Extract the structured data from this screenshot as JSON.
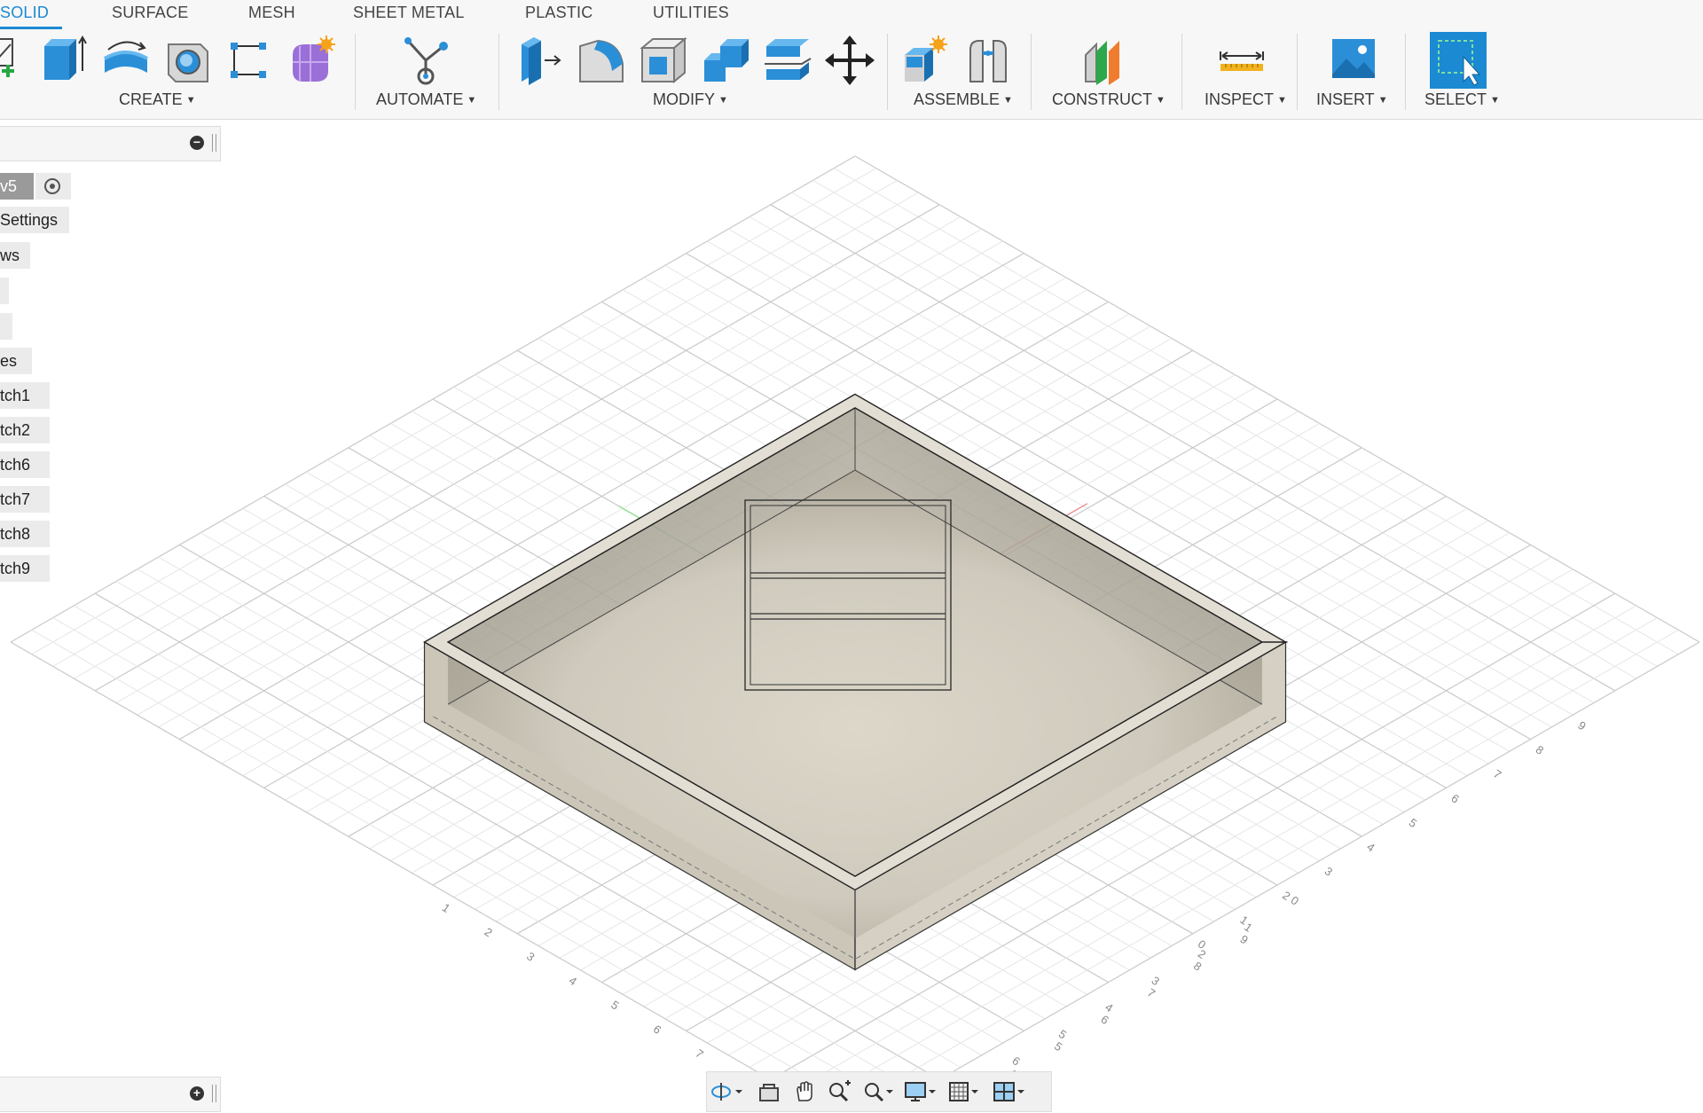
{
  "tabs": [
    "SOLID",
    "SURFACE",
    "MESH",
    "SHEET METAL",
    "PLASTIC",
    "UTILITIES"
  ],
  "groups": {
    "create": "CREATE",
    "automate": "AUTOMATE",
    "modify": "MODIFY",
    "assemble": "ASSEMBLE",
    "construct": "CONSTRUCT",
    "inspect": "INSPECT",
    "insert": "INSERT",
    "select": "SELECT"
  },
  "browser": {
    "document": "v5",
    "items": [
      "Settings",
      "ws",
      "",
      "",
      "es",
      "tch1",
      "tch2",
      "tch6",
      "tch7",
      "tch8",
      "tch9"
    ]
  },
  "icons": {
    "create": [
      "create-sketch-icon",
      "extrude-icon",
      "revolve-icon",
      "hole-icon",
      "pattern-icon",
      "create-form-icon"
    ],
    "automate": [
      "automate-icon"
    ],
    "modify": [
      "press-pull-icon",
      "fillet-icon",
      "shell-icon",
      "combine-icon",
      "split-body-icon",
      "move-icon"
    ],
    "assemble": [
      "new-component-icon",
      "joint-icon"
    ],
    "construct": [
      "plane-icon"
    ],
    "inspect": [
      "measure-icon"
    ],
    "insert": [
      "insert-image-icon"
    ],
    "select": [
      "select-icon"
    ],
    "navigation": [
      "orbit-icon",
      "look-at-icon",
      "pan-icon",
      "zoom-icon",
      "zoom-window-icon",
      "display-settings-icon",
      "grid-settings-icon",
      "viewports-icon"
    ]
  },
  "grid_labels": {
    "left_axis": [
      "9",
      "8",
      "7",
      "6",
      "5",
      "4",
      "3",
      "2",
      "1",
      "0"
    ],
    "front_left": [
      "1",
      "2",
      "3",
      "4",
      "5",
      "6",
      "7",
      "8",
      "9"
    ],
    "front_right": [
      "0",
      "1",
      "2",
      "3",
      "4",
      "5",
      "6",
      "7",
      "8"
    ],
    "right_axis": [
      "1",
      "2",
      "3",
      "4",
      "5",
      "6",
      "7",
      "8",
      "9"
    ]
  },
  "colors": {
    "accent": "#1b8ad3",
    "body_fill": "#cfcabd",
    "x_axis": "#e88b8b",
    "y_axis": "#8fe08f"
  }
}
